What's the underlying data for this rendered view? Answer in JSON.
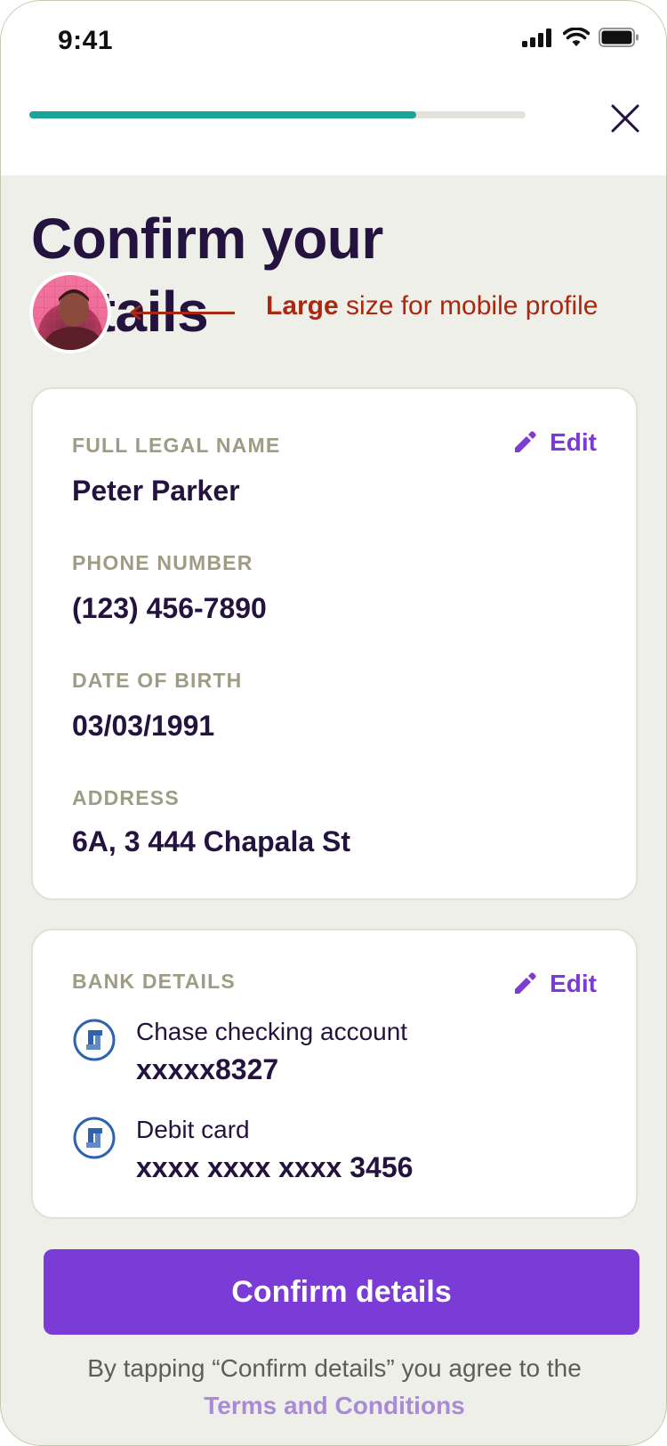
{
  "status_bar": {
    "time": "9:41"
  },
  "progress": {
    "fraction": 0.78
  },
  "header": {
    "title": "Confirm your details"
  },
  "annotation": {
    "bold": "Large",
    "rest": " size for mobile profile"
  },
  "personal": {
    "edit_label": "Edit",
    "fields": [
      {
        "label": "FULL LEGAL NAME",
        "value": "Peter Parker"
      },
      {
        "label": "PHONE NUMBER",
        "value": "(123) 456-7890"
      },
      {
        "label": "DATE OF BIRTH",
        "value": "03/03/1991"
      },
      {
        "label": "ADDRESS",
        "value": "6A, 3 444 Chapala St"
      }
    ]
  },
  "bank": {
    "label": "BANK DETAILS",
    "edit_label": "Edit",
    "accounts": [
      {
        "name": "Chase checking account",
        "number": "xxxxx8327"
      },
      {
        "name": "Debit card",
        "number": "xxxx xxxx xxxx 3456"
      }
    ]
  },
  "confirm_button": "Confirm details",
  "footer": {
    "text": "By tapping “Confirm details” you agree to the",
    "link": "Terms and Conditions"
  },
  "colors": {
    "accent": "#7b3bd6",
    "progress": "#1aa49a",
    "annotation": "#a8290f",
    "title": "#24123f",
    "label": "#9e9c84"
  },
  "icons": [
    "signal-icon",
    "wifi-icon",
    "battery-icon",
    "close-icon",
    "pencil-icon",
    "chase-logo-icon"
  ]
}
